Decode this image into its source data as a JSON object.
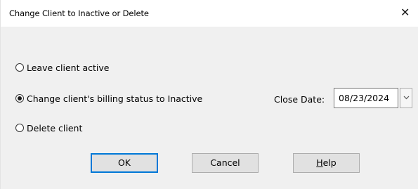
{
  "window": {
    "title": "Change Client to Inactive or Delete",
    "close_glyph": "✕"
  },
  "options": [
    {
      "label": "Leave client active",
      "selected": false
    },
    {
      "label": "Change client's billing status to Inactive",
      "selected": true
    },
    {
      "label": "Delete client",
      "selected": false
    }
  ],
  "close_date": {
    "label": "Close Date:",
    "value": "08/23/2024",
    "dropdown_icon": "chevron-down-icon"
  },
  "buttons": {
    "ok": "OK",
    "cancel": "Cancel",
    "help_first": "H",
    "help_rest": "elp"
  },
  "colors": {
    "accent": "#0078d7",
    "dialog_bg": "#f0f0f0"
  }
}
